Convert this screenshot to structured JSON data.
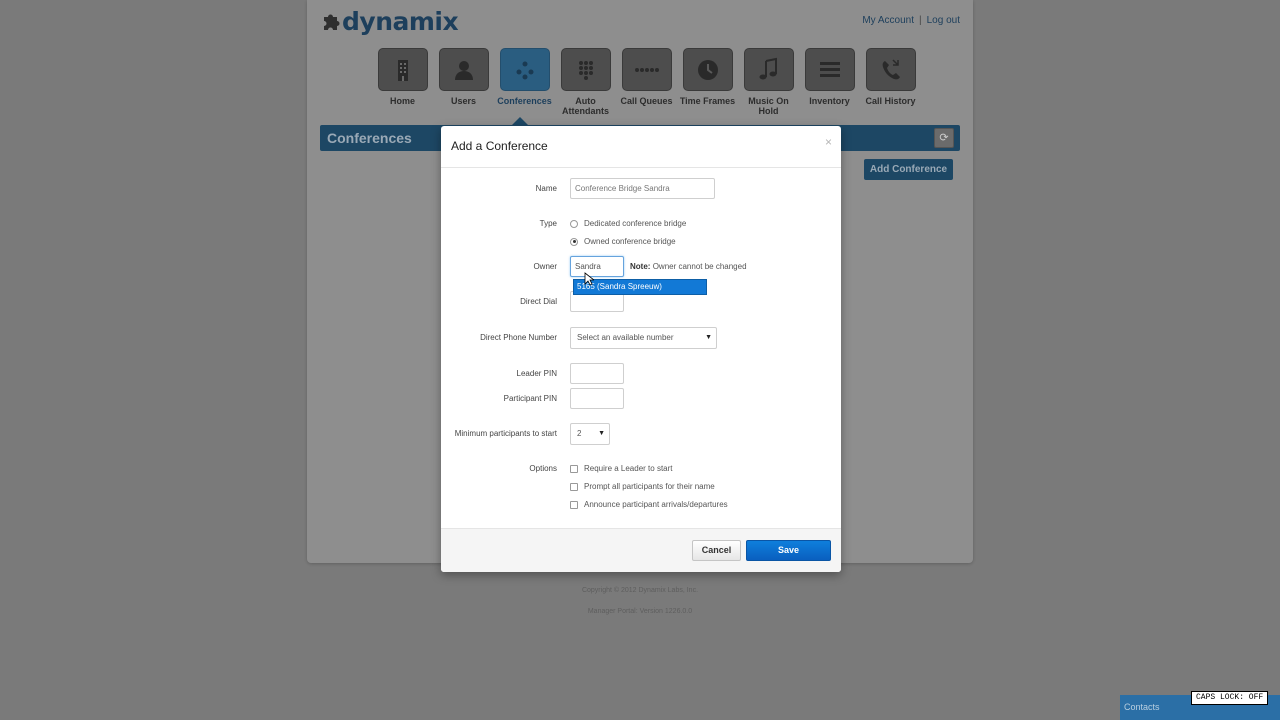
{
  "brand": {
    "name": "dynamix"
  },
  "top_links": {
    "account": "My Account",
    "separator": "|",
    "logout": "Log out"
  },
  "nav": {
    "items": [
      {
        "label": "Home",
        "icon": "building-icon"
      },
      {
        "label": "Users",
        "icon": "user-icon"
      },
      {
        "label": "Conferences",
        "icon": "conference-icon",
        "active": true
      },
      {
        "label": "Auto Attendants",
        "icon": "keypad-icon"
      },
      {
        "label": "Call Queues",
        "icon": "dots-icon"
      },
      {
        "label": "Time Frames",
        "icon": "clock-icon"
      },
      {
        "label": "Music On Hold",
        "icon": "music-icon"
      },
      {
        "label": "Inventory",
        "icon": "list-icon"
      },
      {
        "label": "Call History",
        "icon": "phone-history-icon"
      }
    ]
  },
  "section": {
    "title": "Conferences",
    "add_button": "Add Conference"
  },
  "footer": {
    "copyright": "Copyright © 2012 Dynamix Labs, Inc.",
    "version": "Manager Portal: Version 1226.0.0"
  },
  "modal": {
    "title": "Add a Conference",
    "close": "×",
    "name_label": "Name",
    "name_placeholder": "Conference Bridge Sandra",
    "type_label": "Type",
    "type_options": [
      "Dedicated conference bridge",
      "Owned conference bridge"
    ],
    "type_selected": "Owned conference bridge",
    "owner_label": "Owner",
    "owner_value": "Sandra",
    "owner_note_bold": "Note:",
    "owner_note": "Owner cannot be changed",
    "owner_suggestion": "5165 (Sandra Spreeuw)",
    "direct_dial_label": "Direct Dial",
    "direct_phone_label": "Direct Phone Number",
    "direct_phone_select": "Select an available number",
    "leader_pin_label": "Leader PIN",
    "participant_pin_label": "Participant PIN",
    "min_participants_label": "Minimum participants to start",
    "min_participants_value": "2",
    "options_label": "Options",
    "options": [
      "Require a Leader to start",
      "Prompt all participants for their name",
      "Announce participant arrivals/departures"
    ],
    "cancel": "Cancel",
    "save": "Save"
  },
  "contacts": {
    "label": "Contacts"
  },
  "caps_lock": "CAPS LOCK: OFF",
  "colors": {
    "brand_dark": "#1d4764",
    "primary": "#0a5fbf",
    "suggestion": "#1279d6"
  }
}
